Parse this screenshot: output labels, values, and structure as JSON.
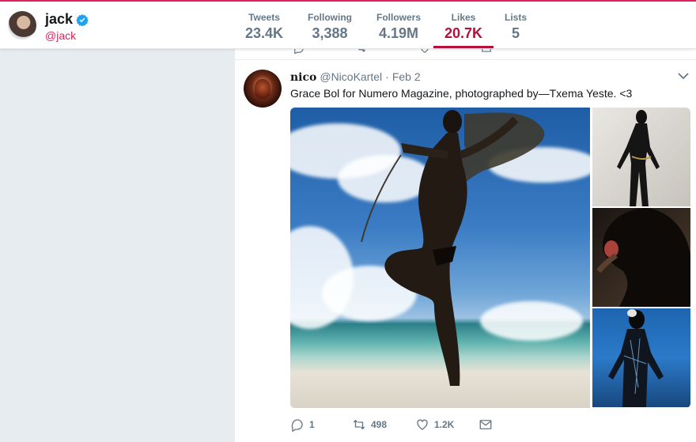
{
  "profile": {
    "display_name": "jack",
    "handle": "@jack",
    "verified_icon": "verified-badge-icon"
  },
  "nav": [
    {
      "label": "Tweets",
      "value": "23.4K"
    },
    {
      "label": "Following",
      "value": "3,388"
    },
    {
      "label": "Followers",
      "value": "4.19M"
    },
    {
      "label": "Likes",
      "value": "20.7K",
      "active": true
    },
    {
      "label": "Lists",
      "value": "5"
    }
  ],
  "colors": {
    "accent": "#b3123c",
    "handle": "#e0245e",
    "muted": "#657786",
    "background": "#e6ecf0"
  },
  "tweet": {
    "author_name": "nico",
    "author_handle": "@NicoKartel",
    "separator": "·",
    "date": "Feb 2",
    "text": "Grace Bol for Numero Magazine, photographed by—Txema Yeste. <3",
    "actions": {
      "reply_count": "1",
      "retweet_count": "498",
      "like_count": "1.2K"
    }
  }
}
